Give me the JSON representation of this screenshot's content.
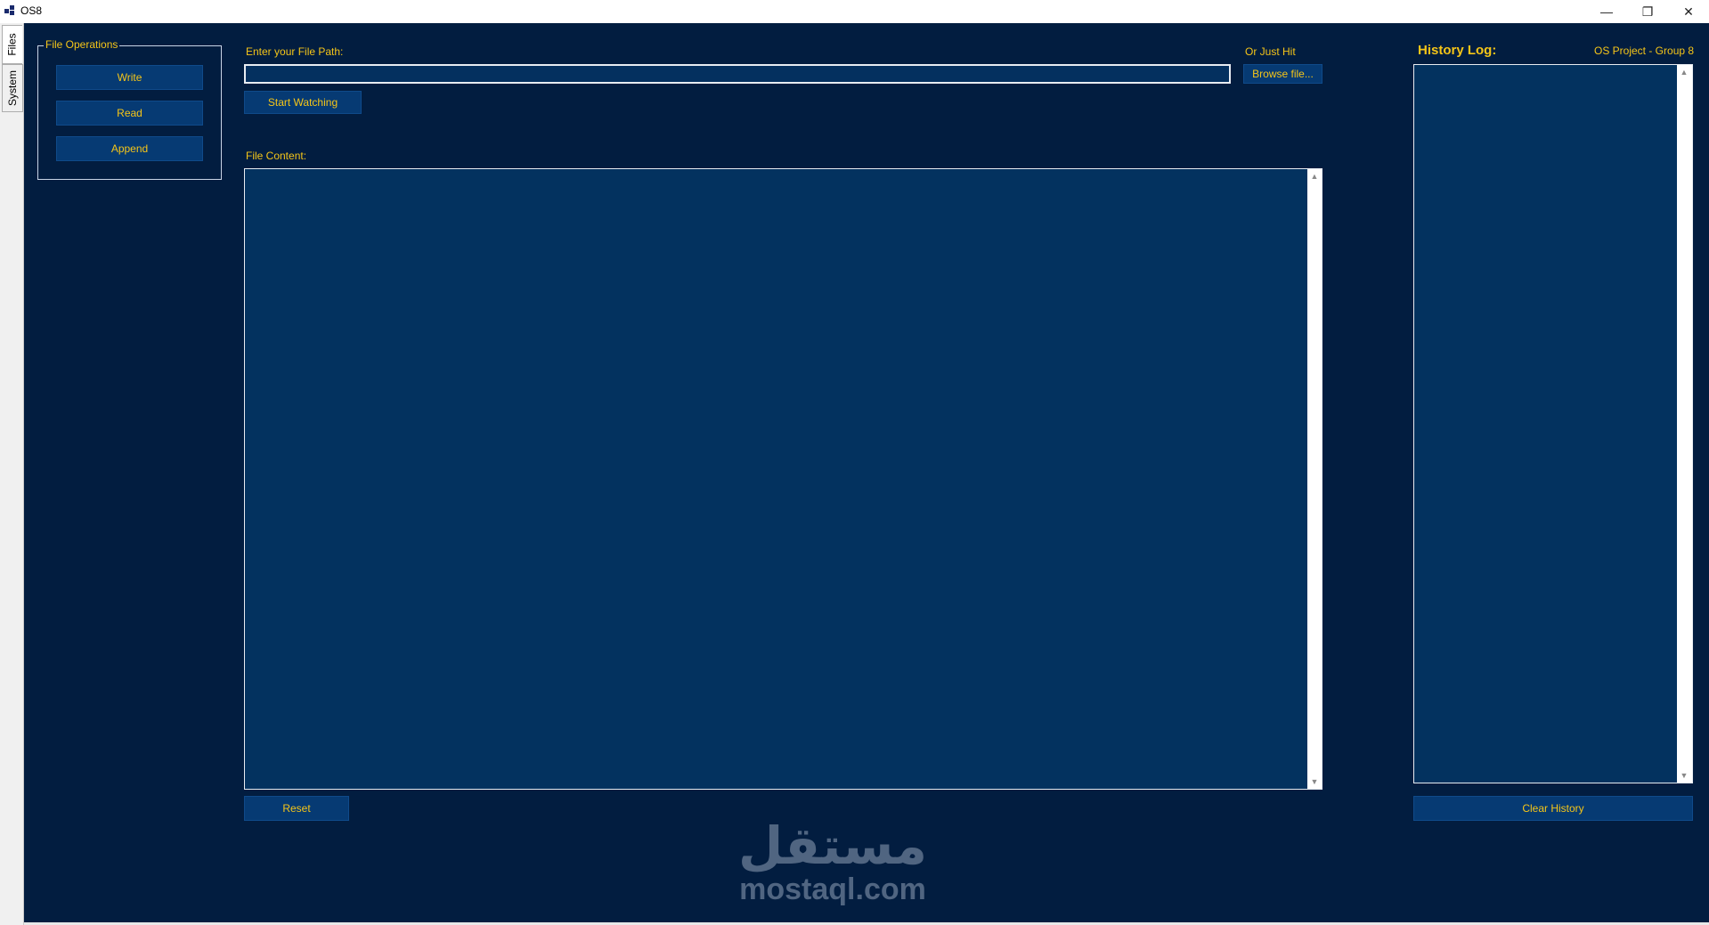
{
  "window": {
    "title": "OS8",
    "minimize_glyph": "—",
    "restore_glyph": "❐",
    "close_glyph": "✕"
  },
  "tabs": [
    {
      "label": "Files",
      "active": true
    },
    {
      "label": "System",
      "active": false
    }
  ],
  "file_operations": {
    "title": "File Operations",
    "buttons": [
      "Write",
      "Read",
      "Append"
    ]
  },
  "path": {
    "label": "Enter your File Path:",
    "value": "",
    "or_label": "Or Just Hit",
    "browse_label": "Browse file...",
    "start_label": "Start Watching"
  },
  "content": {
    "label": "File Content:",
    "value": "",
    "reset_label": "Reset"
  },
  "history": {
    "title": "History Log:",
    "project_label": "OS Project - Group 8",
    "clear_label": "Clear History"
  },
  "watermark": {
    "arabic": "مستقل",
    "latin": "mostaql.com"
  },
  "colors": {
    "background": "#021d40",
    "panel": "#03325f",
    "button": "#063a73",
    "accent_text": "#f5c518"
  }
}
